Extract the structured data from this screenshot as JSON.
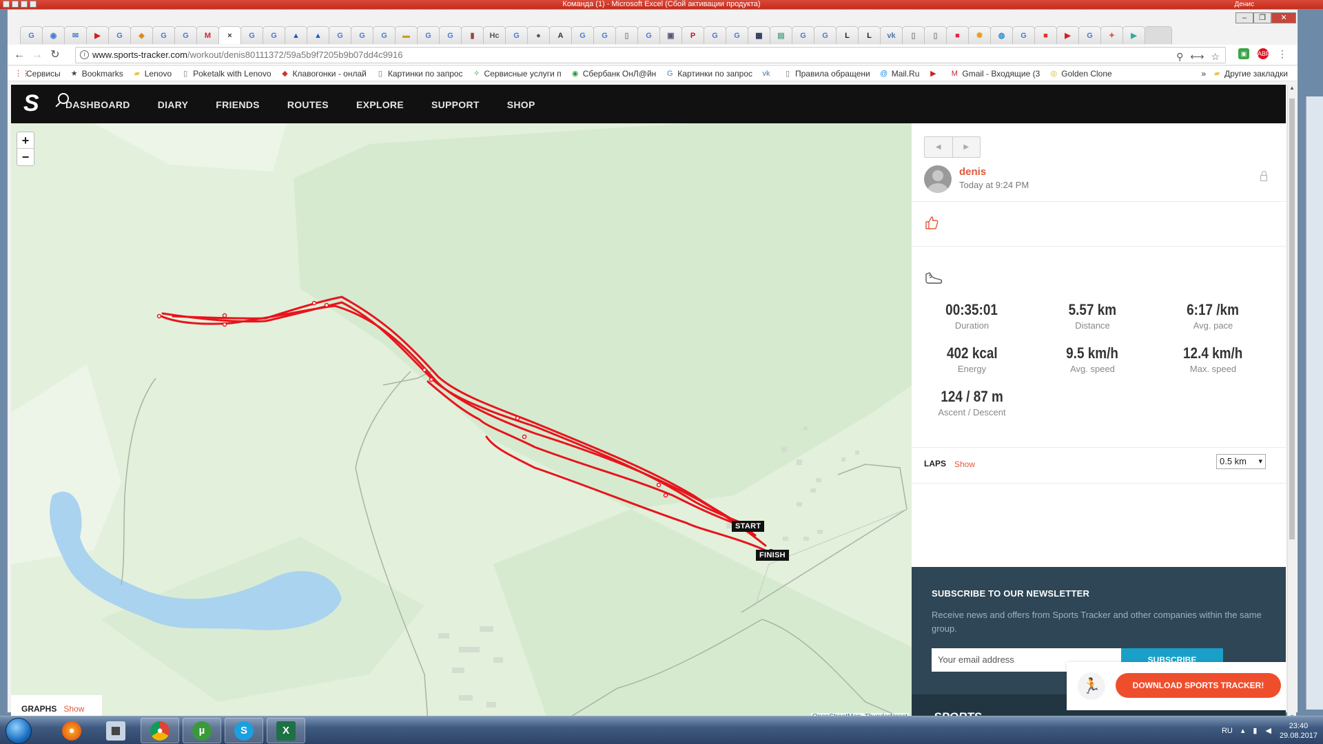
{
  "excel": {
    "title": "Команда (1) - Microsoft Excel (Сбой активации продукта)",
    "user": "Денис"
  },
  "browser": {
    "url_host": "www.sports-tracker.com",
    "url_path": "/workout/denis80111372/59a5b9f7205b9b07dd4c9916",
    "active_tab_close": "×",
    "bookmarks": [
      {
        "label": "Сервисы",
        "icon": "apps-icon"
      },
      {
        "label": "Bookmarks",
        "icon": "star-icon"
      },
      {
        "label": "Lenovo",
        "icon": "folder-icon"
      },
      {
        "label": "Poketalk with Lenovo",
        "icon": "page-icon"
      },
      {
        "label": "Клавогонки - онлай",
        "icon": "car-icon"
      },
      {
        "label": "Картинки по запрос",
        "icon": "page-icon"
      },
      {
        "label": "Сервисные услуги п",
        "icon": "leaf-icon"
      },
      {
        "label": "Сбербанк ОнЛ@йн",
        "icon": "sber-icon"
      },
      {
        "label": "Картинки по запрос",
        "icon": "google-icon"
      },
      {
        "label": "",
        "icon": "vk-icon"
      },
      {
        "label": "Правила обращени",
        "icon": "page-icon"
      },
      {
        "label": "Mail.Ru",
        "icon": "mailru-icon"
      },
      {
        "label": "",
        "icon": "youtube-icon"
      },
      {
        "label": "Gmail - Входящие (3",
        "icon": "gmail-icon"
      },
      {
        "label": "Golden Clone",
        "icon": "golden-icon"
      }
    ],
    "bookmarks_more": "»",
    "other_bookmarks": "Другие закладки"
  },
  "site": {
    "nav": [
      "DASHBOARD",
      "DIARY",
      "FRIENDS",
      "ROUTES",
      "EXPLORE",
      "SUPPORT",
      "SHOP"
    ]
  },
  "map": {
    "zoom_in": "+",
    "zoom_out": "−",
    "start_label": "START",
    "finish_label": "FINISH",
    "graphs_label": "GRAPHS",
    "graphs_show": "Show",
    "attribution_osm": "OpenStreetMap",
    "attribution_sep": ", ",
    "attribution_tf": "Thunderforest"
  },
  "workout": {
    "user_name": "denis",
    "time": "Today at 9:24 PM",
    "stats": [
      {
        "value": "00:35:01",
        "label": "Duration"
      },
      {
        "value": "5.57 km",
        "label": "Distance"
      },
      {
        "value": "6:17 /km",
        "label": "Avg. pace"
      },
      {
        "value": "402 kcal",
        "label": "Energy"
      },
      {
        "value": "9.5 km/h",
        "label": "Avg. speed"
      },
      {
        "value": "12.4 km/h",
        "label": "Max. speed"
      },
      {
        "value": "124 / 87 m",
        "label": "Ascent / Descent"
      }
    ],
    "laps_label": "LAPS",
    "laps_show": "Show",
    "laps_value": "0.5 km"
  },
  "newsletter": {
    "title": "SUBSCRIBE TO OUR NEWSLETTER",
    "text": "Receive news and offers from Sports Tracker and other companies within the same group.",
    "placeholder": "Your email address",
    "button": "SUBSCRIBE",
    "footer_brand": "SPORTS"
  },
  "download": {
    "button": "DOWNLOAD SPORTS TRACKER!"
  },
  "taskbar": {
    "lang": "RU",
    "time": "23:40",
    "date": "29.08.2017"
  },
  "colors": {
    "accent": "#e0583a",
    "route": "#e8141c",
    "nav_bg": "#111111",
    "newsletter_bg": "#2e4655",
    "subscribe": "#1aa0c8",
    "download": "#ef4e2d",
    "map_bg": "#e3f0dc",
    "water": "#aad3f0"
  }
}
